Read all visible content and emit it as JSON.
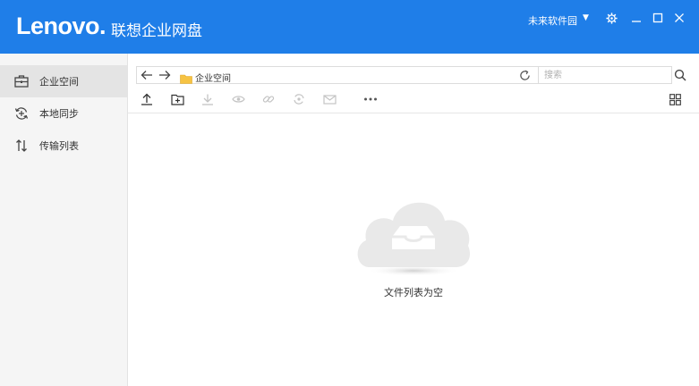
{
  "header": {
    "logo": "Lenovo.",
    "title": "联想企业网盘",
    "user": "未来软件园",
    "accent": "#1f7ee8"
  },
  "sidebar": {
    "items": [
      {
        "label": "企业空间",
        "icon": "briefcase-icon",
        "active": true
      },
      {
        "label": "本地同步",
        "icon": "sync-icon"
      },
      {
        "label": "传输列表",
        "icon": "transfer-icon"
      }
    ]
  },
  "address": {
    "path": "企业空间",
    "search_placeholder": "搜索"
  },
  "toolbar": {
    "tools": [
      "upload-icon",
      "new-folder-icon",
      "download-icon",
      "preview-icon",
      "link-icon",
      "share-icon",
      "mail-icon",
      "more-icon",
      "grid-view-icon"
    ]
  },
  "content": {
    "empty_message": "文件列表为空"
  }
}
